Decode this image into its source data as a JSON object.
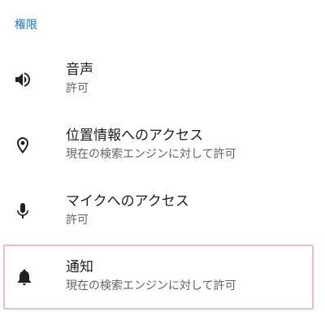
{
  "section": {
    "title": "権限"
  },
  "permissions": [
    {
      "icon": "volume-icon",
      "title": "音声",
      "subtitle": "許可"
    },
    {
      "icon": "location-pin-icon",
      "title": "位置情報へのアクセス",
      "subtitle": "現在の検索エンジンに対して許可"
    },
    {
      "icon": "microphone-icon",
      "title": "マイクへのアクセス",
      "subtitle": "許可"
    },
    {
      "icon": "bell-icon",
      "title": "通知",
      "subtitle": "現在の検索エンジンに対して許可",
      "highlighted": true
    }
  ],
  "colors": {
    "accent": "#1a73e8",
    "highlight_border": "#f2b8d0"
  }
}
